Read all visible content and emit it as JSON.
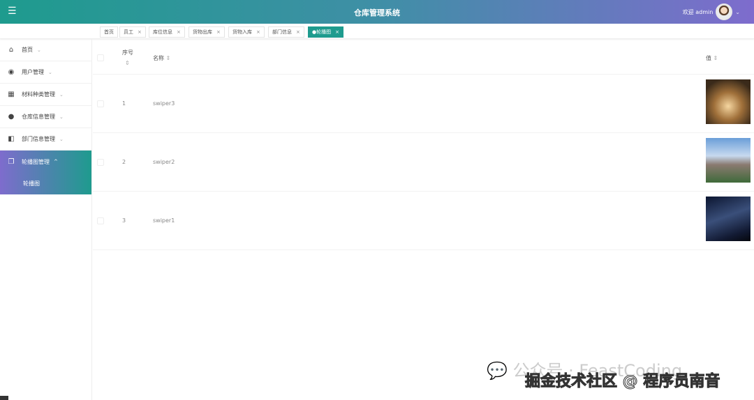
{
  "header": {
    "menu_icon": "hamburger-icon",
    "title": "仓库管理系统",
    "welcome": "欢迎 admin"
  },
  "tabs": [
    {
      "label": "首页",
      "closable": false
    },
    {
      "label": "员工",
      "closable": true
    },
    {
      "label": "库位信息",
      "closable": true
    },
    {
      "label": "货物出库",
      "closable": true
    },
    {
      "label": "货物入库",
      "closable": true
    },
    {
      "label": "部门信息",
      "closable": true
    },
    {
      "label": "●轮播图",
      "closable": true,
      "active": true
    }
  ],
  "close_glyph": "×",
  "sidebar": {
    "items": [
      {
        "label": "首页",
        "icon": "home-icon"
      },
      {
        "label": "用户管理",
        "icon": "user-icon"
      },
      {
        "label": "材料种类管理",
        "icon": "building-icon"
      },
      {
        "label": "仓库信息管理",
        "icon": "drop-icon"
      },
      {
        "label": "部门信息管理",
        "icon": "panel-icon"
      },
      {
        "label": "轮播图管理",
        "icon": "copy-icon",
        "expanded": true
      }
    ],
    "sub_item": "轮播图"
  },
  "table": {
    "headers": {
      "index": "序号",
      "name": "名称",
      "value": "值"
    },
    "rows": [
      {
        "index": "1",
        "name": "swiper3"
      },
      {
        "index": "2",
        "name": "swiper2"
      },
      {
        "index": "3",
        "name": "swiper1"
      }
    ]
  },
  "watermark": {
    "line1": "公众号 · FeastCoding",
    "line2": "掘金技术社区 @ 程序员南音"
  }
}
